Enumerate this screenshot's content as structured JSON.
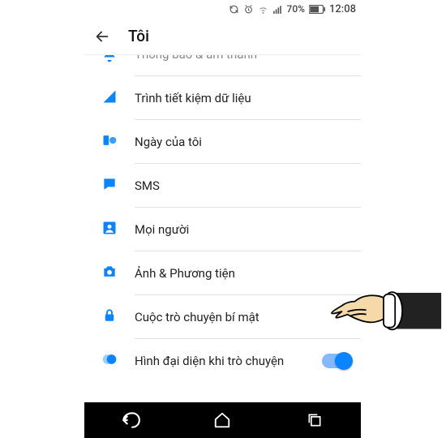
{
  "statusbar": {
    "battery_pct": "70%",
    "time": "12:08"
  },
  "appbar": {
    "title": "Tôi"
  },
  "list": {
    "item0": {
      "label": "Thông báo & âm thanh"
    },
    "item1": {
      "label": "Trình tiết kiệm dữ liệu"
    },
    "item2": {
      "label": "Ngày của tôi"
    },
    "item3": {
      "label": "SMS"
    },
    "item4": {
      "label": "Mọi người"
    },
    "item5": {
      "label": "Ảnh & Phương tiện"
    },
    "item6": {
      "label": "Cuộc trò chuyện bí mật"
    },
    "item7": {
      "label": "Hình đại diện khi trò chuyện"
    }
  },
  "colors": {
    "accent": "#0a84ff"
  }
}
